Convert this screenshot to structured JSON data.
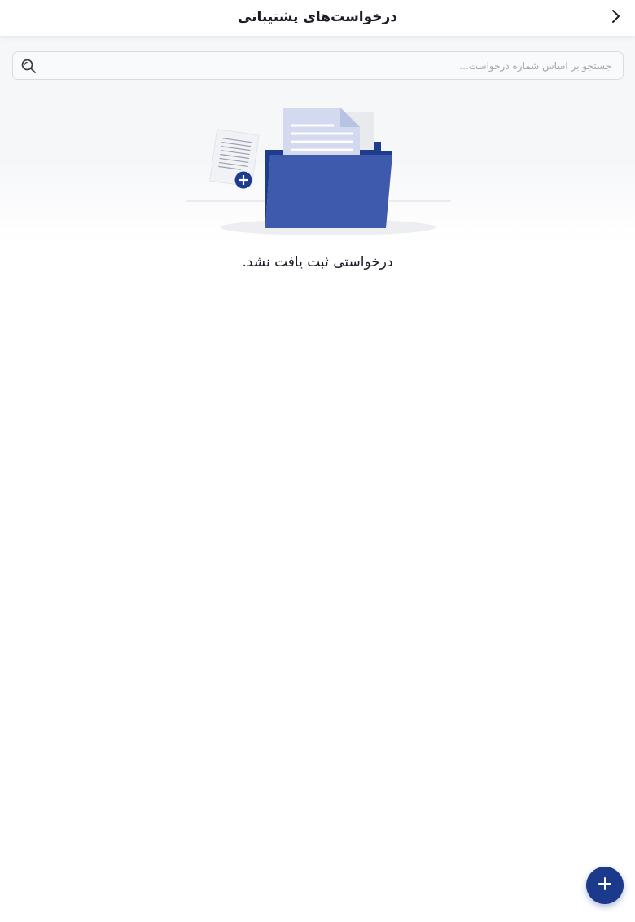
{
  "header": {
    "title": "درخواست‌های پشتیبانی",
    "back_icon": "chevron-right-icon"
  },
  "search": {
    "value": "",
    "placeholder": "جستجو بر اساس شماره درخواست...",
    "icon": "search-icon"
  },
  "empty_state": {
    "illustration": "folder-documents-illustration",
    "message": "درخواستی ثبت یافت نشد."
  },
  "fab": {
    "icon": "plus-icon"
  },
  "colors": {
    "accent": "#1c3a8c",
    "folder": "#3d5aad",
    "folder_dark": "#1f3b8e",
    "document": "#d3daf0",
    "background_top": "#f6f7f9",
    "text_primary": "#1c1c28",
    "placeholder": "#a3a7ae"
  }
}
